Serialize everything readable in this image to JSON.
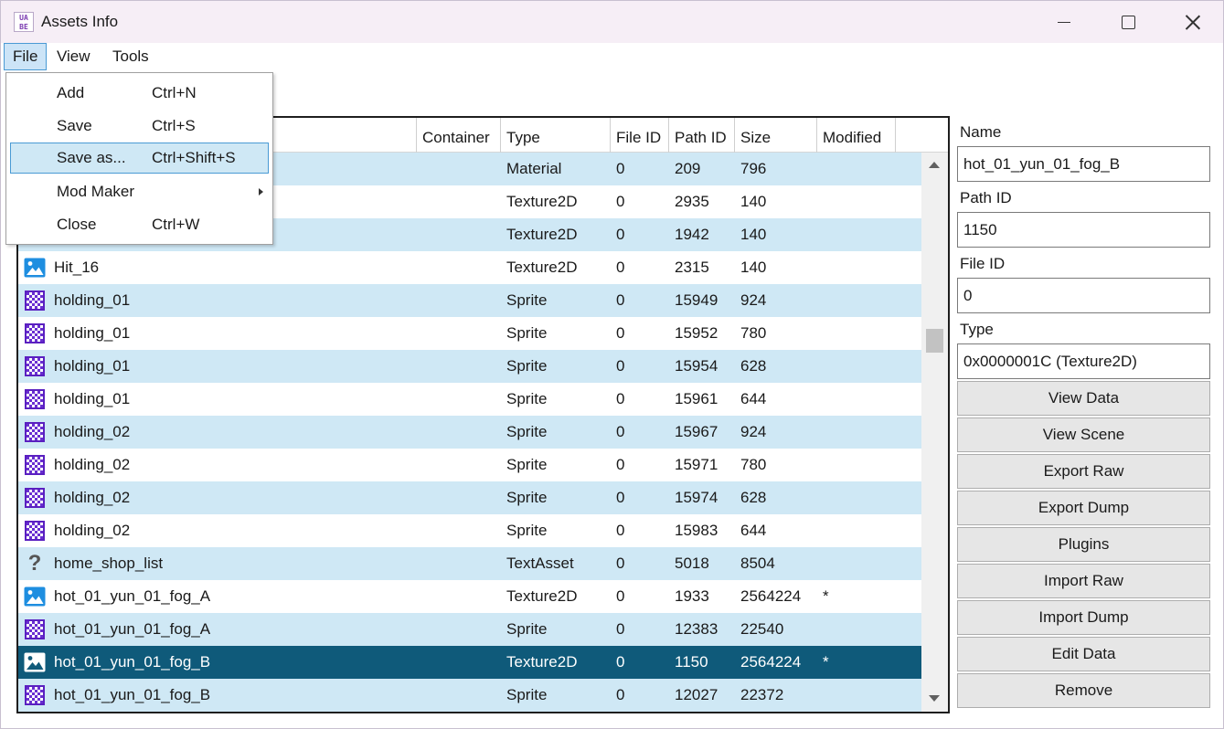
{
  "window": {
    "title": "Assets Info",
    "icon_text": "UA BE"
  },
  "menubar": {
    "file": "File",
    "view": "View",
    "tools": "Tools"
  },
  "file_menu": {
    "items": [
      {
        "label": "Add",
        "shortcut": "Ctrl+N"
      },
      {
        "label": "Save",
        "shortcut": "Ctrl+S"
      },
      {
        "label": "Save as...",
        "shortcut": "Ctrl+Shift+S"
      },
      {
        "label": "Mod Maker",
        "shortcut": ""
      },
      {
        "label": "Close",
        "shortcut": "Ctrl+W"
      }
    ]
  },
  "table": {
    "columns": [
      "Container",
      "Type",
      "File ID",
      "Path ID",
      "Size",
      "Modified"
    ],
    "rows": [
      {
        "icon": "sprite-icon",
        "name": "",
        "type": "Material",
        "file_id": "0",
        "path_id": "209",
        "size": "796",
        "modified": ""
      },
      {
        "icon": "texture-icon",
        "name": "",
        "type": "Texture2D",
        "file_id": "0",
        "path_id": "2935",
        "size": "140",
        "modified": ""
      },
      {
        "icon": "texture-icon",
        "name": "",
        "type": "Texture2D",
        "file_id": "0",
        "path_id": "1942",
        "size": "140",
        "modified": ""
      },
      {
        "icon": "texture-icon",
        "name": "Hit_16",
        "type": "Texture2D",
        "file_id": "0",
        "path_id": "2315",
        "size": "140",
        "modified": ""
      },
      {
        "icon": "sprite-icon",
        "name": "holding_01",
        "type": "Sprite",
        "file_id": "0",
        "path_id": "15949",
        "size": "924",
        "modified": ""
      },
      {
        "icon": "sprite-icon",
        "name": "holding_01",
        "type": "Sprite",
        "file_id": "0",
        "path_id": "15952",
        "size": "780",
        "modified": ""
      },
      {
        "icon": "sprite-icon",
        "name": "holding_01",
        "type": "Sprite",
        "file_id": "0",
        "path_id": "15954",
        "size": "628",
        "modified": ""
      },
      {
        "icon": "sprite-icon",
        "name": "holding_01",
        "type": "Sprite",
        "file_id": "0",
        "path_id": "15961",
        "size": "644",
        "modified": ""
      },
      {
        "icon": "sprite-icon",
        "name": "holding_02",
        "type": "Sprite",
        "file_id": "0",
        "path_id": "15967",
        "size": "924",
        "modified": ""
      },
      {
        "icon": "sprite-icon",
        "name": "holding_02",
        "type": "Sprite",
        "file_id": "0",
        "path_id": "15971",
        "size": "780",
        "modified": ""
      },
      {
        "icon": "sprite-icon",
        "name": "holding_02",
        "type": "Sprite",
        "file_id": "0",
        "path_id": "15974",
        "size": "628",
        "modified": ""
      },
      {
        "icon": "sprite-icon",
        "name": "holding_02",
        "type": "Sprite",
        "file_id": "0",
        "path_id": "15983",
        "size": "644",
        "modified": ""
      },
      {
        "icon": "unknown-icon",
        "name": "home_shop_list",
        "type": "TextAsset",
        "file_id": "0",
        "path_id": "5018",
        "size": "8504",
        "modified": ""
      },
      {
        "icon": "texture-icon",
        "name": "hot_01_yun_01_fog_A",
        "type": "Texture2D",
        "file_id": "0",
        "path_id": "1933",
        "size": "2564224",
        "modified": "*"
      },
      {
        "icon": "sprite-icon",
        "name": "hot_01_yun_01_fog_A",
        "type": "Sprite",
        "file_id": "0",
        "path_id": "12383",
        "size": "22540",
        "modified": ""
      },
      {
        "icon": "texture-icon",
        "name": "hot_01_yun_01_fog_B",
        "type": "Texture2D",
        "file_id": "0",
        "path_id": "1150",
        "size": "2564224",
        "modified": "*"
      },
      {
        "icon": "sprite-icon",
        "name": "hot_01_yun_01_fog_B",
        "type": "Sprite",
        "file_id": "0",
        "path_id": "12027",
        "size": "22372",
        "modified": ""
      }
    ],
    "selected_index": 15
  },
  "details": {
    "name_label": "Name",
    "name_value": "hot_01_yun_01_fog_B",
    "path_id_label": "Path ID",
    "path_id_value": "1150",
    "file_id_label": "File ID",
    "file_id_value": "0",
    "type_label": "Type",
    "type_value": "0x0000001C (Texture2D)"
  },
  "actions": {
    "view_data": "View Data",
    "view_scene": "View Scene",
    "export_raw": "Export Raw",
    "export_dump": "Export Dump",
    "plugins": "Plugins",
    "import_raw": "Import Raw",
    "import_dump": "Import Dump",
    "edit_data": "Edit Data",
    "remove": "Remove"
  },
  "colors": {
    "row_alt": "#cfe8f5",
    "row_selected": "#0f5a7a",
    "sprite_icon": "#6a2fd1",
    "texture_icon": "#1e8ee0"
  }
}
